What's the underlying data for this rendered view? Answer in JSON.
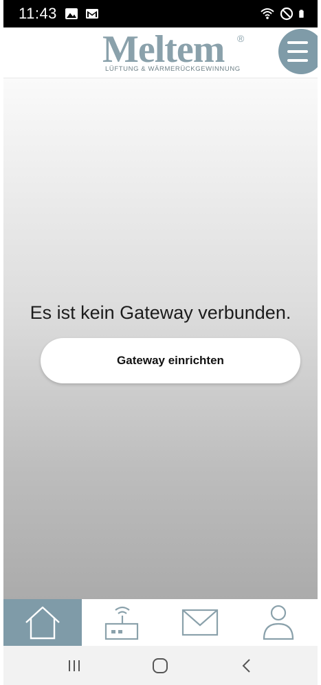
{
  "status_bar": {
    "time": "11:43",
    "left_icons": [
      "image-icon",
      "gmail-icon"
    ],
    "right_icons": [
      "wifi-icon",
      "do-not-disturb-icon",
      "battery-icon"
    ]
  },
  "header": {
    "logo_text": "Meltem",
    "logo_registered": "®",
    "logo_tagline": "LÜFTUNG & WÄRMERÜCKGEWINNUNG",
    "menu_icon": "hamburger-icon"
  },
  "main": {
    "message": "Es ist kein Gateway verbunden.",
    "setup_button_label": "Gateway einrichten"
  },
  "tabs": [
    {
      "icon": "home-icon",
      "active": true
    },
    {
      "icon": "gateway-router-icon",
      "active": false
    },
    {
      "icon": "mail-icon",
      "active": false
    },
    {
      "icon": "user-icon",
      "active": false
    }
  ],
  "nav_bar": {
    "buttons": [
      "recent-apps-icon",
      "home-circle-icon",
      "back-icon"
    ]
  },
  "colors": {
    "accent": "#7f9ba8",
    "logo": "#8aa1ab",
    "status_bar": "#000000"
  }
}
